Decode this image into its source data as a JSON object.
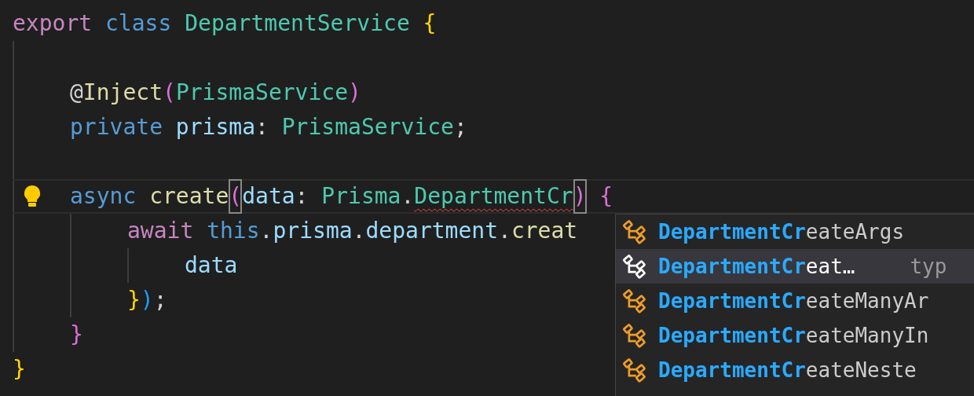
{
  "editor": {
    "lines": [
      {
        "tokens": [
          {
            "text": "export",
            "kind": "keyword"
          },
          {
            "text": " class",
            "kind": "storage"
          },
          {
            "text": " DepartmentService",
            "kind": "type"
          },
          {
            "text": " {",
            "kind": "bracket1"
          }
        ],
        "children": [
          {
            "kind": "blank"
          },
          {
            "tokens": [
              {
                "text": "@",
                "kind": "punct"
              },
              {
                "text": "Inject",
                "kind": "func"
              },
              {
                "text": "(",
                "kind": "bracket2"
              },
              {
                "text": "PrismaService",
                "kind": "type"
              },
              {
                "text": ")",
                "kind": "bracket2"
              }
            ]
          },
          {
            "tokens": [
              {
                "text": "private",
                "kind": "storage"
              },
              {
                "text": " prisma",
                "kind": "var"
              },
              {
                "text": ":",
                "kind": "punct"
              },
              {
                "text": " PrismaService",
                "kind": "type"
              },
              {
                "text": ";",
                "kind": "punct"
              }
            ]
          },
          {
            "kind": "blank"
          },
          {
            "current": true,
            "lightbulb": true,
            "tokens": [
              {
                "text": "async",
                "kind": "storage"
              },
              {
                "text": " create",
                "kind": "func"
              },
              {
                "text": "(",
                "kind": "bracket2",
                "matched": true
              },
              {
                "text": "data",
                "kind": "var"
              },
              {
                "text": ":",
                "kind": "punct"
              },
              {
                "text": " Prisma",
                "kind": "type"
              },
              {
                "text": ".",
                "kind": "punct"
              },
              {
                "text": "DepartmentCr",
                "kind": "type",
                "error": true
              },
              {
                "text": ")",
                "kind": "bracket2",
                "matched": true
              },
              {
                "text": " {",
                "kind": "bracket2"
              }
            ],
            "children": [
              {
                "tokens": [
                  {
                    "text": "await",
                    "kind": "keyword"
                  },
                  {
                    "text": " this",
                    "kind": "storage"
                  },
                  {
                    "text": ".",
                    "kind": "punct"
                  },
                  {
                    "text": "prisma",
                    "kind": "var"
                  },
                  {
                    "text": ".",
                    "kind": "punct"
                  },
                  {
                    "text": "department",
                    "kind": "var"
                  },
                  {
                    "text": ".",
                    "kind": "punct"
                  },
                  {
                    "text": "creat",
                    "kind": "func"
                  }
                ],
                "children": [
                  {
                    "tokens": [
                      {
                        "text": "data",
                        "kind": "var"
                      }
                    ]
                  }
                ]
              },
              {
                "tokens": [
                  {
                    "text": "}",
                    "kind": "bracket1"
                  },
                  {
                    "text": ")",
                    "kind": "bracket3"
                  },
                  {
                    "text": ";",
                    "kind": "punct"
                  }
                ]
              }
            ]
          },
          {
            "tokens": [
              {
                "text": "}",
                "kind": "bracket2"
              }
            ]
          }
        ]
      },
      {
        "tokens": [
          {
            "text": "}",
            "kind": "bracket1"
          }
        ]
      }
    ]
  },
  "suggestions": {
    "items": [
      {
        "match": "DepartmentCr",
        "rest": "eateArgs",
        "selected": false
      },
      {
        "match": "DepartmentCr",
        "rest": "eat…",
        "detail": "typ",
        "selected": true
      },
      {
        "match": "DepartmentCr",
        "rest": "eateManyAr",
        "selected": false
      },
      {
        "match": "DepartmentCr",
        "rest": "eateManyIn",
        "selected": false
      },
      {
        "match": "DepartmentCr",
        "rest": "eateNeste",
        "selected": false
      }
    ]
  }
}
